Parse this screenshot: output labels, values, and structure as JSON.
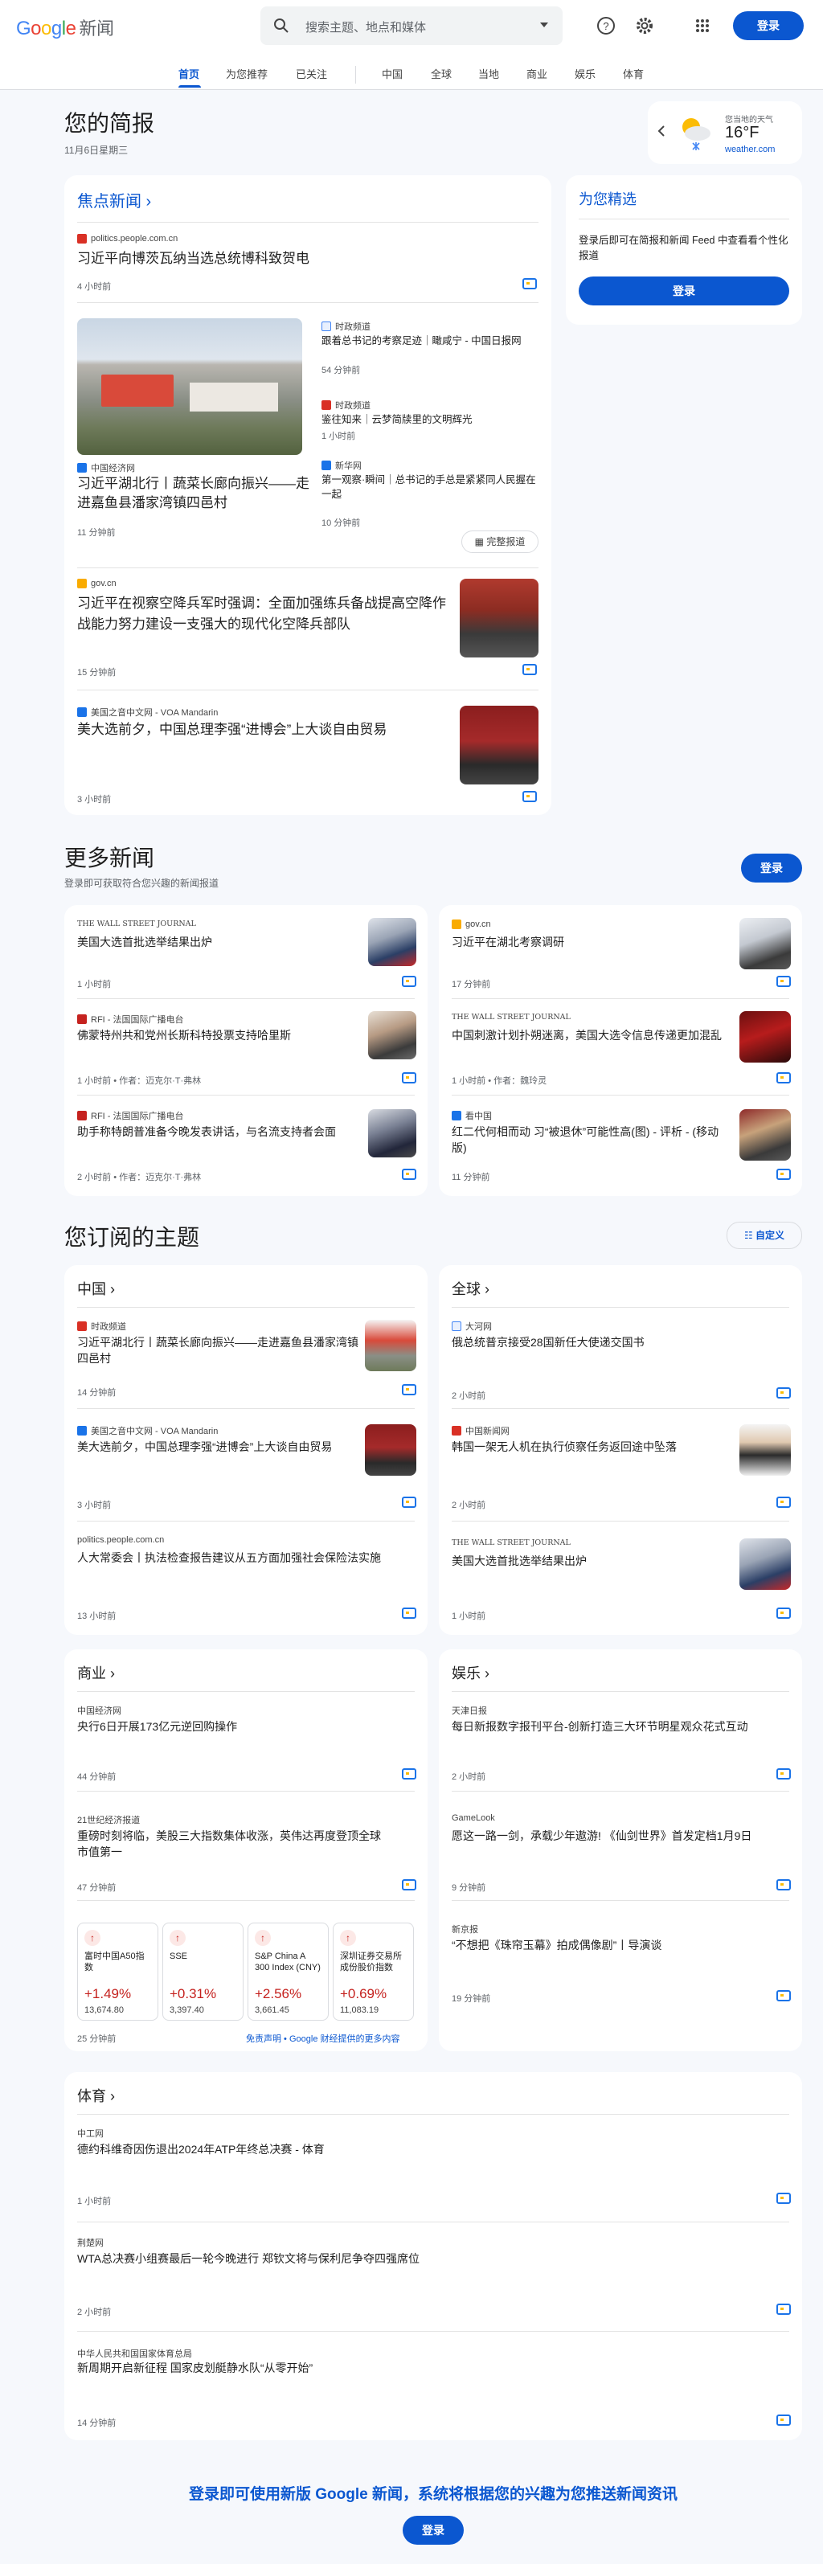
{
  "header": {
    "logo_text": "Google",
    "logo_suffix": "新闻",
    "search_placeholder": "搜索主题、地点和媒体",
    "signin": "登录"
  },
  "tabs": [
    "首页",
    "为您推荐",
    "已关注",
    "中国",
    "全球",
    "当地",
    "商业",
    "娱乐",
    "体育"
  ],
  "briefing": {
    "title": "您的简报",
    "date": "11月6日星期三"
  },
  "weather": {
    "label": "您当地的天气",
    "temp": "16°F",
    "source": "weather.com"
  },
  "top": {
    "section": "焦点新闻",
    "s1": {
      "source": "politics.people.com.cn",
      "title": "习近平向博茨瓦纳当选总统博科致贺电",
      "time": "4 小时前"
    },
    "s2": {
      "source": "中国经济网",
      "title": "习近平湖北行丨蔬菜长廊向振兴——走进嘉鱼县潘家湾镇四邑村",
      "time": "11 分钟前",
      "r1_source": "时政频道",
      "r1_title": "跟着总书记的考察足迹｜瞰咸宁 - 中国日报网",
      "r1_time": "54 分钟前",
      "r2_source": "时政频道",
      "r2_title": "鉴往知来｜云梦简牍里的文明辉光",
      "r2_time": "1 小时前",
      "r3_source": "新华网",
      "r3_title": "第一观察·瞬间｜总书记的手总是紧紧同人民握在一起",
      "r3_time": "10 分钟前",
      "full": "完整报道"
    },
    "s3": {
      "source": "gov.cn",
      "title": "习近平在视察空降兵军时强调：全面加强练兵备战提高空降作战能力努力建设一支强大的现代化空降兵部队",
      "time": "15 分钟前"
    },
    "s4": {
      "source": "美国之音中文网 - VOA Mandarin",
      "title": "美大选前夕，中国总理李强“进博会”上大谈自由贸易",
      "time": "3 小时前"
    }
  },
  "picks": {
    "title": "为您精选",
    "desc": "登录后即可在简报和新闻 Feed 中查看看个性化报道",
    "btn": "登录"
  },
  "more": {
    "title": "更多新闻",
    "sub": "登录即可获取符合您兴趣的新闻报道",
    "btn": "登录",
    "items": [
      {
        "source": "THE WALL STREET JOURNAL",
        "title": "美国大选首批选举结果出炉",
        "time": "1 小时前"
      },
      {
        "source": "gov.cn",
        "title": "习近平在湖北考察调研",
        "time": "17 分钟前"
      },
      {
        "source": "RFI - 法国国际广播电台",
        "title": "佛蒙特州共和党州长斯科特投票支持哈里斯",
        "time": "1 小时前 • 作者：迈克尔·T·弗林"
      },
      {
        "source": "THE WALL STREET JOURNAL",
        "title": "中国刺激计划扑朔迷离，美国大选令信息传递更加混乱",
        "time": "1 小时前 • 作者：魏玲灵"
      },
      {
        "source": "RFI - 法国国际广播电台",
        "title": "助手称特朗普准备今晚发表讲话，与名流支持者会面",
        "time": "2 小时前 • 作者：迈克尔·T·弗林"
      },
      {
        "source": "看中国",
        "title": "红二代何相而动 习“被退休”可能性高(图) - 评析 - (移动版)",
        "time": "11 分钟前"
      }
    ]
  },
  "topics": {
    "title": "您订阅的主题",
    "custom": "自定义",
    "china": {
      "name": "中国",
      "items": [
        {
          "source": "时政频道",
          "title": "习近平湖北行丨蔬菜长廊向振兴——走进嘉鱼县潘家湾镇四邑村",
          "time": "14 分钟前"
        },
        {
          "source": "美国之音中文网 - VOA Mandarin",
          "title": "美大选前夕，中国总理李强“进博会”上大谈自由贸易",
          "time": "3 小时前"
        },
        {
          "source": "politics.people.com.cn",
          "title": "人大常委会丨执法检查报告建议从五方面加强社会保险法实施",
          "time": "13 小时前"
        }
      ]
    },
    "world": {
      "name": "全球",
      "items": [
        {
          "source": "大河网",
          "title": "俄总统普京接受28国新任大使递交国书",
          "time": "2 小时前"
        },
        {
          "source": "中国新闻网",
          "title": "韩国一架无人机在执行侦察任务返回途中坠落",
          "time": "2 小时前"
        },
        {
          "source": "THE WALL STREET JOURNAL",
          "title": "美国大选首批选举结果出炉",
          "time": "1 小时前"
        }
      ]
    },
    "biz": {
      "name": "商业",
      "items": [
        {
          "source": "中国经济网",
          "title": "央行6日开展173亿元逆回购操作",
          "time": "44 分钟前"
        },
        {
          "source": "21世纪经济报道",
          "title": "重磅时刻将临，美股三大指数集体收涨，英伟达再度登顶全球市值第一",
          "time": "47 分钟前"
        }
      ],
      "tiles": [
        {
          "name": "富时中国A50指数",
          "pct": "+1.49%",
          "val": "13,674.80"
        },
        {
          "name": "SSE",
          "pct": "+0.31%",
          "val": "3,397.40"
        },
        {
          "name": "S&P China A 300 Index (CNY)",
          "pct": "+2.56%",
          "val": "3,661.45"
        },
        {
          "name": "深圳证券交易所成份股价指数",
          "pct": "+0.69%",
          "val": "11,083.19"
        }
      ],
      "tiles_time": "25 分钟前",
      "disclaimer": "免责声明 • Google 财经提供的更多内容"
    },
    "ent": {
      "name": "娱乐",
      "items": [
        {
          "source": "天津日报",
          "title": "每日新报数字报刊平台-创新打造三大环节明星观众花式互动",
          "time": "2 小时前"
        },
        {
          "source": "GameLook",
          "title": "愿这一路一剑，承载少年遨游! 《仙剑世界》首发定档1月9日",
          "time": "9 分钟前"
        },
        {
          "source": "新京报",
          "title": "“不想把《珠帘玉幕》拍成偶像剧”丨导演谈",
          "time": "19 分钟前"
        }
      ]
    },
    "sports": {
      "name": "体育",
      "items": [
        {
          "source": "中工网",
          "title": "德约科维奇因伤退出2024年ATP年终总决赛 - 体育",
          "time": "1 小时前"
        },
        {
          "source": "荆楚网",
          "title": "WTA总决赛小组赛最后一轮今晚进行 郑钦文将与保利尼争夺四强席位",
          "time": "2 小时前"
        },
        {
          "source": "中华人民共和国国家体育总局",
          "title": "新周期开启新征程 国家皮划艇静水队“从零开始”",
          "time": "14 分钟前"
        }
      ]
    }
  },
  "footer": {
    "text": "登录即可使用新版 Google 新闻，系统将根据您的兴趣为您推送新闻资讯",
    "btn": "登录"
  }
}
